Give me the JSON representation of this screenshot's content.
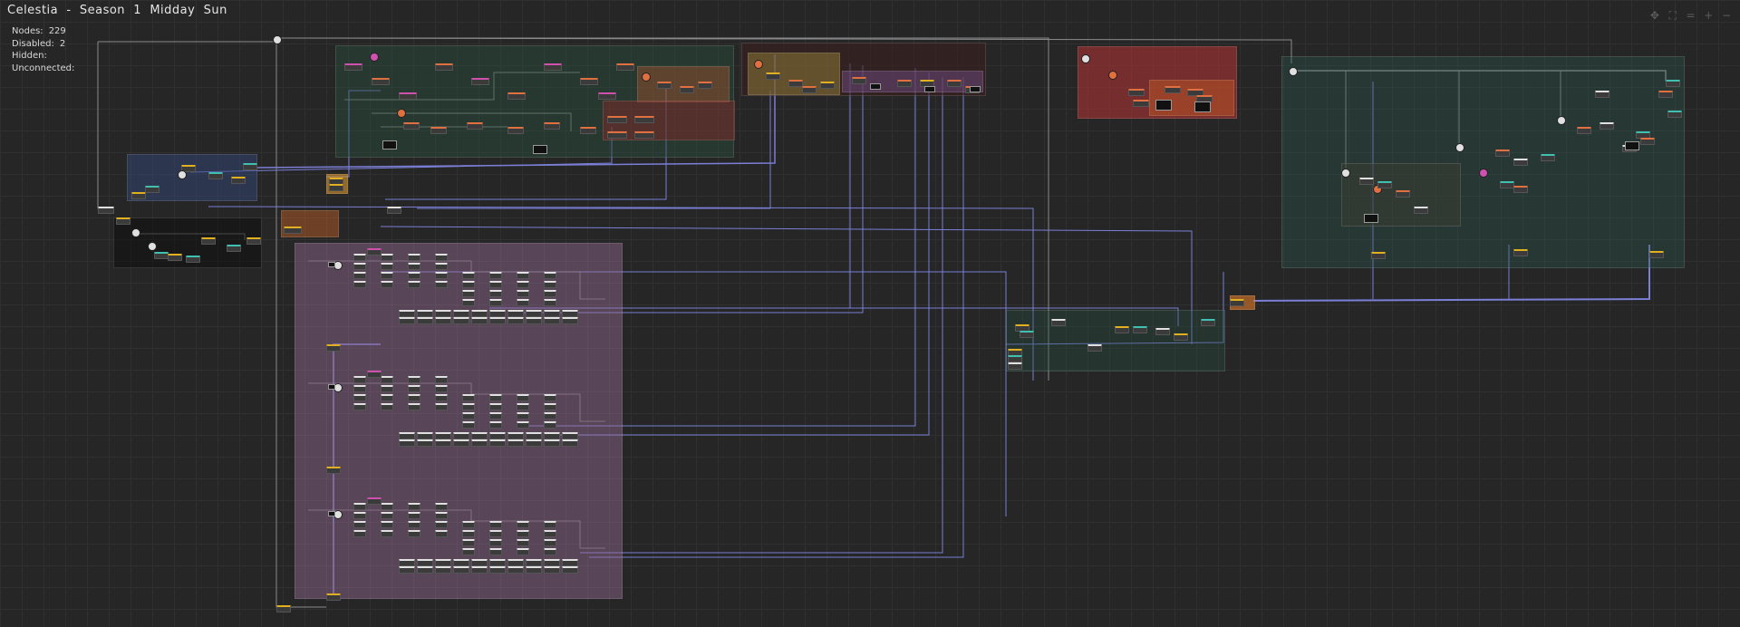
{
  "window": {
    "title": "Celestia  -  Season  1  Midday  Sun"
  },
  "stats": {
    "nodes_label": "Nodes:",
    "nodes_value": "229",
    "disabled_label": "Disabled:",
    "disabled_value": "2",
    "hidden_label": "Hidden:",
    "hidden_value": "",
    "unconnected_label": "Unconnected:",
    "unconnected_value": ""
  },
  "toolbar": {
    "items": [
      {
        "icon": "move-icon",
        "glyph": "✥"
      },
      {
        "icon": "fit-view-icon",
        "glyph": "⛶"
      },
      {
        "icon": "align-icon",
        "glyph": "="
      },
      {
        "icon": "zoom-in-icon",
        "glyph": "+"
      },
      {
        "icon": "zoom-out-icon",
        "glyph": "−"
      }
    ]
  },
  "colors": {
    "background": "#262626",
    "grid": "#303030",
    "wire_main": "#7b7fd6",
    "wire_gray": "#8a8a8a",
    "node_yellow": "#e0b020",
    "node_orange": "#e07040",
    "node_pink": "#d050b0",
    "node_teal": "#40c0b0",
    "node_white": "#e0e0e0",
    "group_green": "#1f3a30",
    "group_blue": "#24304a",
    "group_purple": "#5a4560",
    "group_red": "#7a3030",
    "group_teal": "#1f3d3a"
  }
}
